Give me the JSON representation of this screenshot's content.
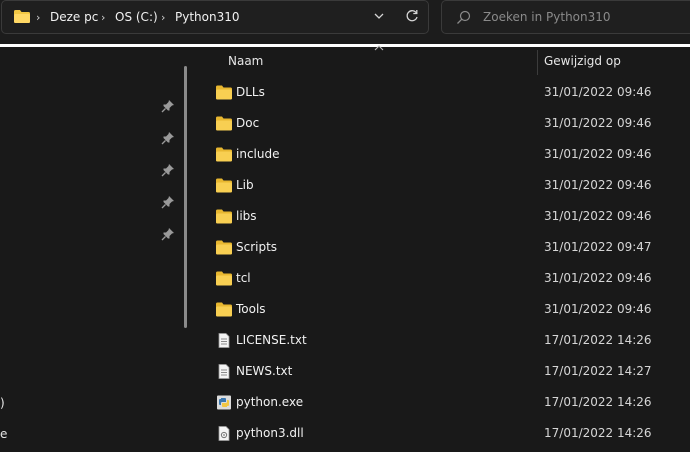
{
  "address_bar": {
    "breadcrumbs": [
      "Deze pc",
      "OS (C:)",
      "Python310"
    ]
  },
  "search": {
    "placeholder": "Zoeken in Python310"
  },
  "nav": {
    "fragments": [
      ")",
      "e"
    ]
  },
  "columns": {
    "name": "Naam",
    "modified": "Gewijzigd op"
  },
  "files": [
    {
      "name": "DLLs",
      "modified": "31/01/2022 09:46",
      "icon": "folder-icon"
    },
    {
      "name": "Doc",
      "modified": "31/01/2022 09:46",
      "icon": "folder-icon"
    },
    {
      "name": "include",
      "modified": "31/01/2022 09:46",
      "icon": "folder-icon"
    },
    {
      "name": "Lib",
      "modified": "31/01/2022 09:46",
      "icon": "folder-icon"
    },
    {
      "name": "libs",
      "modified": "31/01/2022 09:46",
      "icon": "folder-icon"
    },
    {
      "name": "Scripts",
      "modified": "31/01/2022 09:47",
      "icon": "folder-icon"
    },
    {
      "name": "tcl",
      "modified": "31/01/2022 09:46",
      "icon": "folder-icon"
    },
    {
      "name": "Tools",
      "modified": "31/01/2022 09:46",
      "icon": "folder-icon"
    },
    {
      "name": "LICENSE.txt",
      "modified": "17/01/2022 14:26",
      "icon": "text-file-icon"
    },
    {
      "name": "NEWS.txt",
      "modified": "17/01/2022 14:27",
      "icon": "text-file-icon"
    },
    {
      "name": "python.exe",
      "modified": "17/01/2022 14:26",
      "icon": "python-exe-icon"
    },
    {
      "name": "python3.dll",
      "modified": "17/01/2022 14:26",
      "icon": "dll-file-icon"
    }
  ],
  "colors": {
    "folder": "#f2c744",
    "background": "#191919",
    "text": "#f2f2f2"
  }
}
